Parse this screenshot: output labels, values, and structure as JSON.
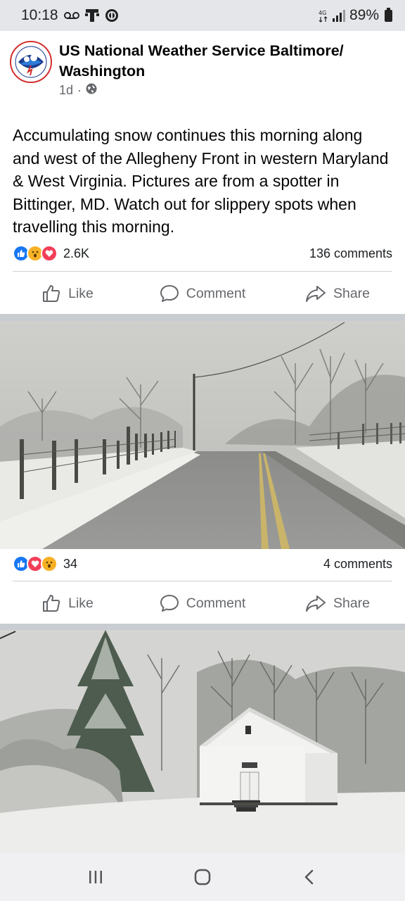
{
  "status_bar": {
    "time": "10:18",
    "battery": "89%",
    "icons": [
      "voicemail-icon",
      "t-mobile-icon",
      "game-icon",
      "network-icon",
      "signal-icon",
      "battery-icon"
    ]
  },
  "post": {
    "page_name": "US National Weather Service Baltimore/ Washington",
    "time_ago": "1d",
    "separator": "·",
    "privacy_icon": "globe-icon",
    "text": "Accumulating snow continues this morning along and west of the Allegheny Front in western Maryland & West Virginia. Pictures are from a spotter in Bittinger, MD. Watch out for slippery spots when travelling this morning.",
    "reactions": [
      "like",
      "wow",
      "love"
    ],
    "reaction_count": "2.6K",
    "comments": "136 comments"
  },
  "actions": {
    "like": "Like",
    "comment": "Comment",
    "share": "Share"
  },
  "photo1": {
    "reactions": [
      "like",
      "love",
      "wow"
    ],
    "reaction_count": "34",
    "comments": "4 comments"
  },
  "nav": {
    "icons": [
      "recent-apps-icon",
      "home-icon",
      "back-icon"
    ]
  },
  "colors": {
    "facebook_blue": "#1877f2",
    "love_red": "#f33e58",
    "wow_yellow": "#f7b125",
    "secondary_text": "#65676b"
  }
}
